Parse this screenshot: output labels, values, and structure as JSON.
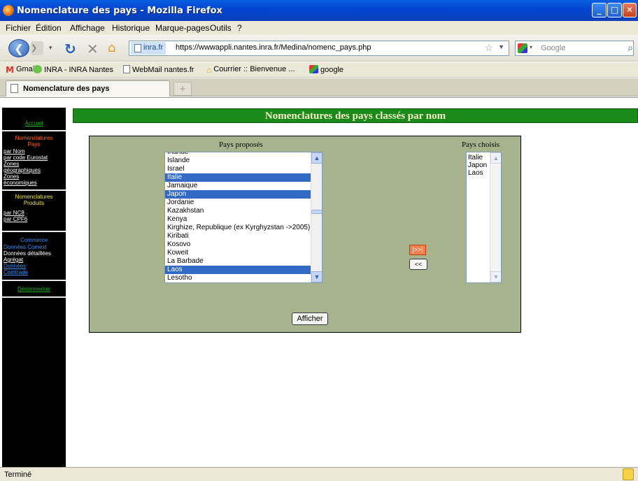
{
  "window": {
    "title": "Nomenclature des pays - Mozilla Firefox",
    "controls": [
      "minimize",
      "maximize",
      "close"
    ]
  },
  "menu": [
    "Fichier",
    "Édition",
    "Affichage",
    "Historique",
    "Marque-pages",
    "Outils",
    "?"
  ],
  "navbar": {
    "site_badge": "inra.fr",
    "url": "https://wwwappli.nantes.inra.fr/Medina/nomenc_pays.php",
    "search_placeholder": "Google"
  },
  "bookmarks": [
    "Gmail",
    "INRA - INRA Nantes",
    "WebMail nantes.fr",
    "Courrier :: Bienvenue ...",
    "google"
  ],
  "tab": {
    "label": "Nomenclature des pays",
    "new_tab": "+"
  },
  "sidebar": {
    "accueil": "Accueil",
    "nom_pays_heading": [
      "Nomenclatures",
      "Pays"
    ],
    "pays_links": [
      "par Nom",
      "par code Eurostat",
      "Zones",
      "géographiques",
      "Zones",
      "économiques"
    ],
    "nom_prod_heading": [
      "Nomenclatures",
      "Produits"
    ],
    "prod_links": [
      "par NC8",
      "par CPF6"
    ],
    "commerce_heading": "Commerce",
    "commerce_items": [
      "Données Comext",
      "Données détaillées",
      "Agrégat",
      "Données",
      "Comtrade"
    ],
    "deconnexion": "Déconnexion"
  },
  "page": {
    "banner": "Nomenclatures des pays classés par nom",
    "proposed_label": "Pays proposés",
    "chosen_label": "Pays choisis",
    "proposed_options": [
      {
        "label": "Irlande",
        "selected": false
      },
      {
        "label": "Islande",
        "selected": false
      },
      {
        "label": "Israel",
        "selected": false
      },
      {
        "label": "Italie",
        "selected": true
      },
      {
        "label": "Jamaique",
        "selected": false
      },
      {
        "label": "Japon",
        "selected": true
      },
      {
        "label": "Jordanie",
        "selected": false
      },
      {
        "label": "Kazakhstan",
        "selected": false
      },
      {
        "label": "Kenya",
        "selected": false
      },
      {
        "label": "Kirghize, Republique (ex Kyrghyzstan ->2005)",
        "selected": false
      },
      {
        "label": "Kiribati",
        "selected": false
      },
      {
        "label": "Kosovo",
        "selected": false
      },
      {
        "label": "Koweit",
        "selected": false
      },
      {
        "label": "La Barbade",
        "selected": false
      },
      {
        "label": "Laos",
        "selected": true
      },
      {
        "label": "Lesotho",
        "selected": false
      }
    ],
    "chosen_options": [
      "Italie",
      "Japon",
      "Laos"
    ],
    "add_button": "|>>|",
    "remove_button": "<<",
    "submit_button": "Afficher",
    "selection_color": "#316ac5"
  },
  "status": {
    "text": "Terminé"
  }
}
